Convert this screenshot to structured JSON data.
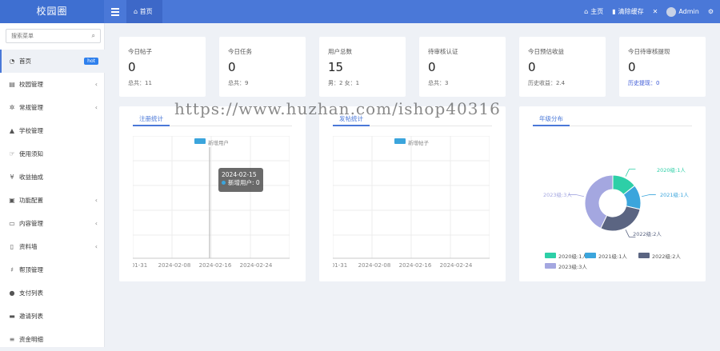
{
  "app": {
    "logo": "校园圈"
  },
  "topbar": {
    "home_tab": "首页",
    "home_link": "主页",
    "clear_cache": "清除缓存",
    "user": "Admin"
  },
  "sidebar": {
    "search_placeholder": "搜索菜单",
    "items": [
      {
        "label": "首页",
        "icon": "dashboard-icon",
        "badge": "hot",
        "active": true
      },
      {
        "label": "校园管理",
        "icon": "users-icon",
        "chevron": true
      },
      {
        "label": "常规管理",
        "icon": "cogs-icon",
        "chevron": true
      },
      {
        "label": "学校管理",
        "icon": "graduation-icon"
      },
      {
        "label": "使用须知",
        "icon": "hand-icon"
      },
      {
        "label": "收益抽成",
        "icon": "yen-icon"
      },
      {
        "label": "功能配置",
        "icon": "file-icon",
        "chevron": true
      },
      {
        "label": "内容管理",
        "icon": "id-card-icon",
        "chevron": true
      },
      {
        "label": "资料墙",
        "icon": "doc-icon",
        "chevron": true
      },
      {
        "label": "帮顶管理",
        "icon": "thumb-icon"
      },
      {
        "label": "支付列表",
        "icon": "wechat-icon"
      },
      {
        "label": "邀请列表",
        "icon": "inbox-icon"
      },
      {
        "label": "资金明细",
        "icon": "list-icon"
      }
    ]
  },
  "stats": [
    {
      "title": "今日帖子",
      "value": "0",
      "sub": "总共：11"
    },
    {
      "title": "今日任务",
      "value": "0",
      "sub": "总共：9"
    },
    {
      "title": "用户总数",
      "value": "15",
      "sub": "男：2  女：1"
    },
    {
      "title": "待审核认证",
      "value": "0",
      "sub": "总共：3"
    },
    {
      "title": "今日预估收益",
      "value": "0",
      "sub": "历史收益：2.4"
    },
    {
      "title": "今日待审核提现",
      "value": "0",
      "sub": "历史提现：0"
    }
  ],
  "panels": {
    "reg": {
      "tab": "注册统计",
      "legend": "新增用户",
      "x_ticks": [
        "01-31",
        "2024-02-08",
        "2024-02-16",
        "2024-02-24"
      ]
    },
    "posts": {
      "tab": "发帖统计",
      "legend": "新增帖子",
      "x_ticks": [
        "01-31",
        "2024-02-08",
        "2024-02-16",
        "2024-02-24"
      ]
    },
    "grade": {
      "tab": "年级分布"
    }
  },
  "tooltip": {
    "date": "2024-02-15",
    "label": "新增用户: 0"
  },
  "chart_data": [
    {
      "type": "line",
      "x_ticks": [
        "01-31",
        "2024-02-08",
        "2024-02-16",
        "2024-02-24"
      ],
      "series": [
        {
          "name": "新增用户",
          "values": []
        }
      ],
      "grid": true,
      "legend": "top"
    },
    {
      "type": "line",
      "x_ticks": [
        "01-31",
        "2024-02-08",
        "2024-02-16",
        "2024-02-24"
      ],
      "series": [
        {
          "name": "新增帖子",
          "values": []
        }
      ],
      "grid": true,
      "legend": "top"
    },
    {
      "type": "pie",
      "categories": [
        "2020级:1人",
        "2021级:1人",
        "2022级:2人",
        "2023级:3人"
      ],
      "values": [
        1,
        1,
        2,
        3
      ],
      "colors": [
        "#2dcfa7",
        "#3ba5dc",
        "#5b6582",
        "#a4a7e0"
      ],
      "legend": "bottom"
    }
  ],
  "watermark": "https://www.huzhan.com/ishop40316"
}
